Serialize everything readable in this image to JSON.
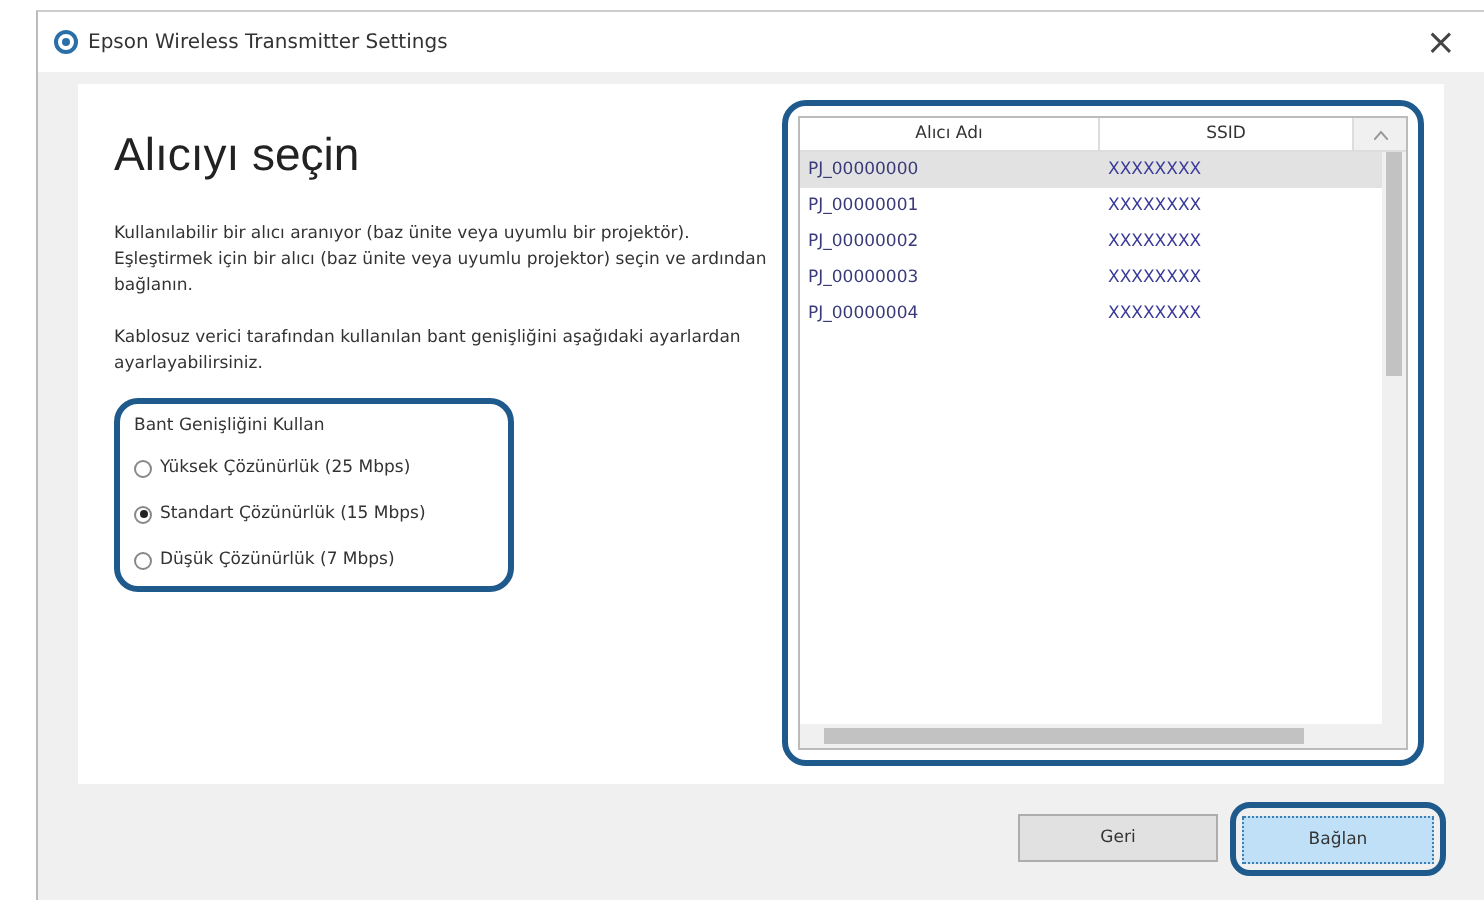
{
  "window": {
    "title": "Epson Wireless Transmitter Settings",
    "close": "×"
  },
  "heading": "Alıcıyı seçin",
  "paragraphs": [
    "Kullanılabilir bir alıcı aranıyor (baz ünite veya uyumlu bir projektör).",
    "Eşleştirmek için bir alıcı (baz ünite veya uyumlu projektor) seçin ve ardından bağlanın.",
    "Kablosuz verici tarafından kullanılan bant genişliğini aşağıdaki ayarlardan ayarlayabilirsiniz."
  ],
  "bandwidth": {
    "label": "Bant Genişliğini Kullan",
    "options": [
      {
        "label": "Yüksek Çözünürlük (25 Mbps)",
        "selected": false
      },
      {
        "label": "Standart Çözünürlük (15 Mbps)",
        "selected": true
      },
      {
        "label": "Düşük Çözünürlük (7 Mbps)",
        "selected": false
      }
    ]
  },
  "table": {
    "columns": [
      "Alıcı Adı",
      "SSID"
    ],
    "rows": [
      {
        "cells": [
          "PJ_00000000",
          "XXXXXXXX"
        ],
        "selected": true
      },
      {
        "cells": [
          "PJ_00000001",
          "XXXXXXXX"
        ],
        "selected": false
      },
      {
        "cells": [
          "PJ_00000002",
          "XXXXXXXX"
        ],
        "selected": false
      },
      {
        "cells": [
          "PJ_00000003",
          "XXXXXXXX"
        ],
        "selected": false
      },
      {
        "cells": [
          "PJ_00000004",
          "XXXXXXXX"
        ],
        "selected": false
      }
    ]
  },
  "buttons": [
    {
      "label": "Geri",
      "kind": "normal"
    },
    {
      "label": "Bağlan",
      "kind": "default"
    }
  ]
}
